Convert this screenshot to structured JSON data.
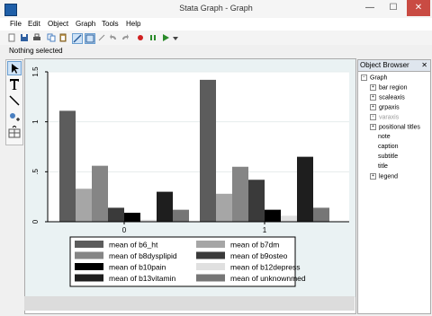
{
  "window": {
    "title": "Stata Graph - Graph",
    "minimize": "—",
    "maximize": "☐",
    "close": "✕"
  },
  "menu": [
    "File",
    "Edit",
    "Object",
    "Graph",
    "Tools",
    "Help"
  ],
  "status": "Nothing selected",
  "object_browser": {
    "title": "Object Browser",
    "close": "✕",
    "root": "Graph",
    "items": [
      {
        "label": "bar region",
        "expandable": true
      },
      {
        "label": "scaleaxis",
        "expandable": true
      },
      {
        "label": "grpaxis",
        "expandable": true
      },
      {
        "label": "varaxis",
        "expandable": true,
        "muted": true
      },
      {
        "label": "positional titles",
        "expandable": true
      },
      {
        "label": "note",
        "expandable": false
      },
      {
        "label": "caption",
        "expandable": false
      },
      {
        "label": "subtitle",
        "expandable": false
      },
      {
        "label": "title",
        "expandable": false
      },
      {
        "label": "legend",
        "expandable": true
      }
    ]
  },
  "chart_data": {
    "type": "bar",
    "categories": [
      "0",
      "1"
    ],
    "ylim": [
      0,
      1.5
    ],
    "yticks": [
      "0",
      ".5",
      "1",
      "1.5"
    ],
    "grid": true,
    "legend_position": "bottom",
    "series": [
      {
        "name": "mean of b6_ht",
        "color": "#5c5c5c",
        "values": [
          1.11,
          1.42
        ]
      },
      {
        "name": "mean of b7dm",
        "color": "#a6a6a6",
        "values": [
          0.33,
          0.28
        ]
      },
      {
        "name": "mean of b8dysplipid",
        "color": "#858585",
        "values": [
          0.56,
          0.55
        ]
      },
      {
        "name": "mean of b9osteo",
        "color": "#3a3a3a",
        "values": [
          0.14,
          0.42
        ]
      },
      {
        "name": "mean of b10pain",
        "color": "#000000",
        "values": [
          0.09,
          0.12
        ]
      },
      {
        "name": "mean of b12depress",
        "color": "#e0e0e0",
        "values": [
          0.02,
          0.06
        ]
      },
      {
        "name": "mean of b13vitamin",
        "color": "#1e1e1e",
        "values": [
          0.3,
          0.65
        ]
      },
      {
        "name": "mean of unknownmed",
        "color": "#767676",
        "values": [
          0.12,
          0.14
        ]
      }
    ]
  }
}
